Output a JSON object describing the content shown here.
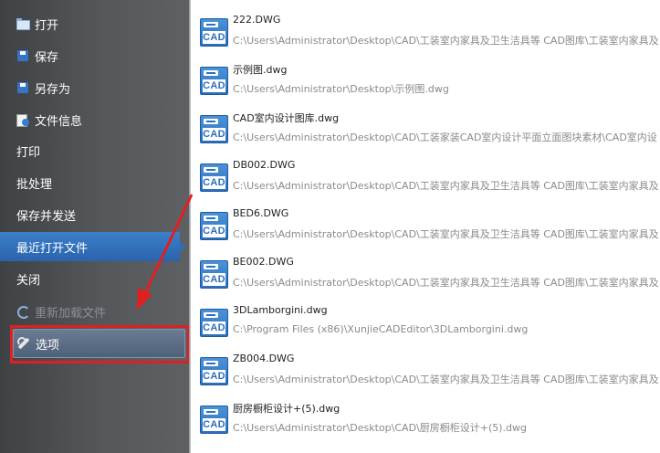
{
  "menu": {
    "items": [
      {
        "label": "打开",
        "icon": "folder-open-icon",
        "enabled": true
      },
      {
        "label": "保存",
        "icon": "save-icon",
        "enabled": true
      },
      {
        "label": "另存为",
        "icon": "save-as-icon",
        "enabled": true
      },
      {
        "label": "文件信息",
        "icon": "file-info-icon",
        "enabled": true
      },
      {
        "label": "打印",
        "enabled": true
      },
      {
        "label": "批处理",
        "enabled": true
      },
      {
        "label": "保存并发送",
        "enabled": true
      },
      {
        "label": "最近打开文件",
        "enabled": true,
        "selected": true
      },
      {
        "label": "关闭",
        "enabled": true
      },
      {
        "label": "重新加载文件",
        "icon": "reload-icon",
        "enabled": false
      },
      {
        "label": "选项",
        "icon": "wrench-icon",
        "enabled": true,
        "highlighted": true
      }
    ]
  },
  "recent_files": [
    {
      "name": "222.DWG",
      "path": "C:\\Users\\Administrator\\Desktop\\CAD\\工装室内家具及卫生洁具等 CAD图库\\工装室内家具及"
    },
    {
      "name": "示例图.dwg",
      "path": "C:\\Users\\Administrator\\Desktop\\示例图.dwg"
    },
    {
      "name": "CAD室内设计图库.dwg",
      "path": "C:\\Users\\Administrator\\Desktop\\CAD\\工装家装CAD室内设计平面立面图块素材\\CAD室内设"
    },
    {
      "name": "DB002.DWG",
      "path": "C:\\Users\\Administrator\\Desktop\\CAD\\工装室内家具及卫生洁具等 CAD图库\\工装室内家具及"
    },
    {
      "name": "BED6.DWG",
      "path": "C:\\Users\\Administrator\\Desktop\\CAD\\工装室内家具及卫生洁具等 CAD图库\\工装室内家具及"
    },
    {
      "name": "BE002.DWG",
      "path": "C:\\Users\\Administrator\\Desktop\\CAD\\工装室内家具及卫生洁具等 CAD图库\\工装室内家具及"
    },
    {
      "name": "3DLamborgini.dwg",
      "path": "C:\\Program Files (x86)\\XunjieCADEditor\\3DLamborgini.dwg"
    },
    {
      "name": "ZB004.DWG",
      "path": "C:\\Users\\Administrator\\Desktop\\CAD\\工装室内家具及卫生洁具等 CAD图库\\工装室内家具及"
    },
    {
      "name": "厨房橱柜设计+(5).dwg",
      "path": "C:\\Users\\Administrator\\Desktop\\CAD\\厨房橱柜设计+(5).dwg"
    }
  ],
  "file_icon_label": "CAD",
  "colors": {
    "sidebar_bg": "#4f5255",
    "selected_bg": "#2f6db7",
    "highlight_border": "#e02020",
    "cad_icon": "#2b6fbf"
  }
}
